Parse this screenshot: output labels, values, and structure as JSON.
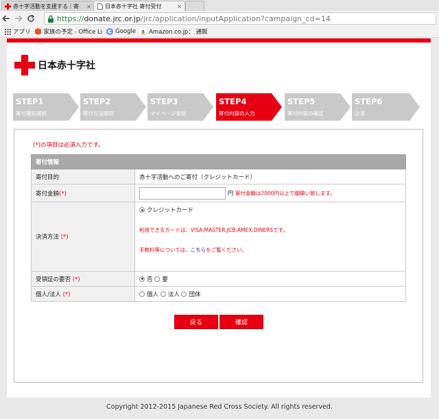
{
  "browser": {
    "tabs": [
      {
        "title": "赤十字活動を支援する｜寄",
        "close": "×"
      },
      {
        "title": "日本赤十字社 寄付受付",
        "close": "×"
      }
    ],
    "url": {
      "scheme": "https://",
      "host": "donate.jrc.or.jp",
      "path": "/jrc/application/inputApplication?campaign_cd=14"
    },
    "bookmarks": [
      {
        "label": "アプリ",
        "icon": "apps-grid-icon"
      },
      {
        "label": "家族の予定 - Office Li",
        "icon": "office-icon"
      },
      {
        "label": "Google",
        "icon": "google-icon"
      },
      {
        "label": "Amazon.co.jp： 通販",
        "icon": "amazon-icon"
      }
    ]
  },
  "header": {
    "org_name": "日本赤十字社"
  },
  "steps": [
    {
      "num": "STEP1",
      "label": "寄付種別選択",
      "active": false
    },
    {
      "num": "STEP2",
      "label": "寄付方法選択",
      "active": false
    },
    {
      "num": "STEP3",
      "label": "マイページ登録",
      "active": false
    },
    {
      "num": "STEP4",
      "label": "寄付内容の入力",
      "active": true
    },
    {
      "num": "STEP5",
      "label": "寄付内容の確認",
      "active": false
    },
    {
      "num": "STEP6",
      "label": "決済",
      "active": false
    }
  ],
  "form": {
    "required_note": "(*)の項目は必須入力です。",
    "section_title": "寄付情報",
    "required_mark": "(*)",
    "rows": {
      "purpose": {
        "label": "寄付目的",
        "value": "赤十字活動へのご寄付（クレジットカード）"
      },
      "amount": {
        "label": "寄付金額",
        "unit": "円",
        "help": "寄付金額は2000円以上で御願い致します。",
        "value": ""
      },
      "payment": {
        "label": "決済方法",
        "option": "クレジットカード",
        "cards_note": "利用できるカードは、VISA,MASTER,JCB,AMEX,DINERSです。",
        "fee_pre": "手数料等については、",
        "fee_link": "こちら",
        "fee_post": "をご覧ください。"
      },
      "receipt": {
        "label": "受領証の要否",
        "options": [
          "否",
          "要"
        ]
      },
      "entity": {
        "label": "個人/法人",
        "options": [
          "個人",
          "法人",
          "団体"
        ]
      }
    },
    "buttons": {
      "back": "戻る",
      "confirm": "確認"
    }
  },
  "footer": {
    "copyright": "Copyright 2012-2015 Japanese Red Cross Society. All rights reserved."
  },
  "colors": {
    "brand_red": "#e60012",
    "step_inactive": "#c9c9c9",
    "table_header": "#a8a8a8"
  }
}
